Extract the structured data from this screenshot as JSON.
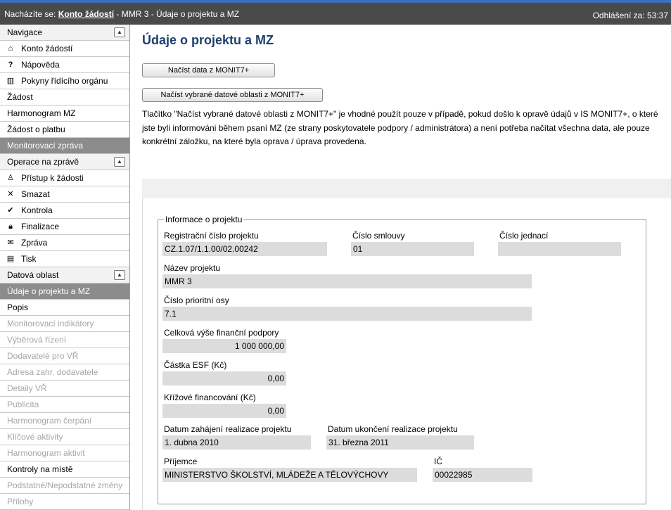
{
  "header": {
    "prefix": "Nacházíte se:",
    "crumb_link": "Konto žádostí",
    "crumb_rest": "- MMR 3 - Údaje o projektu a MZ",
    "timer_label": "Odhlášení za:",
    "timer_value": "53:37"
  },
  "sidebar": {
    "nav_header": "Navigace",
    "nav_items": [
      "Konto žádostí",
      "Nápověda",
      "Pokyny řídícího orgánu"
    ],
    "plain_items": [
      "Žádost",
      "Harmonogram MZ",
      "Žádost o platbu"
    ],
    "monitor_header": "Monitorovací zpráva",
    "ops_header": "Operace na zprávě",
    "ops_items": [
      "Přístup k žádosti",
      "Smazat",
      "Kontrola",
      "Finalizace",
      "Zpráva",
      "Tisk"
    ],
    "data_header": "Datová oblast",
    "data_active": "Údaje o projektu a MZ",
    "data_items": [
      "Popis"
    ],
    "disabled_items": [
      "Monitorovací indikátory",
      "Výběrová řízení",
      "Dodavatelé pro VŘ",
      "Adresa zahr. dodavatele",
      "Detaily VŘ",
      "Publicita",
      "Harmonogram čerpání",
      "Klíčové aktivity",
      "Harmonogram aktivit"
    ],
    "data_items2": [
      "Kontroly na místě"
    ],
    "disabled_items2": [
      "Podstatné/Nepodstatné změny",
      "Přílohy"
    ]
  },
  "main": {
    "title": "Údaje o projektu a MZ",
    "btn_load": "Načíst data z MONIT7+",
    "btn_load_selected": "Načíst vybrané datové oblasti z MONIT7+",
    "description": "Tlačítko \"Načíst vybrané datové oblasti z MONIT7+\" je vhodné použít pouze v případě, pokud došlo k opravě údajů v IS MONIT7+, o které jste byli informováni během psaní MZ (ze strany poskytovatele podpory / administrátora) a není potřeba načítat všechna data, ale pouze konkrétní záložku, na které byla oprava / úprava provedena."
  },
  "project": {
    "legend": "Informace o projektu",
    "reg_label": "Registrační číslo projektu",
    "reg_value": "CZ.1.07/1.1.00/02.00242",
    "contract_label": "Číslo smlouvy",
    "contract_value": "01",
    "ref_label": "Číslo jednací",
    "ref_value": "",
    "name_label": "Název projektu",
    "name_value": "MMR 3",
    "axis_label": "Číslo prioritní osy",
    "axis_value": "7.1",
    "total_label": "Celková výše finanční podpory",
    "total_value": "1 000 000,00",
    "esf_label": "Částka ESF (Kč)",
    "esf_value": "0,00",
    "cross_label": "Křížové financování (Kč)",
    "cross_value": "0,00",
    "start_label": "Datum zahájení realizace projektu",
    "start_value": "1. dubna 2010",
    "end_label": "Datum ukončení realizace projektu",
    "end_value": "31. března 2011",
    "recipient_label": "Příjemce",
    "recipient_value": "MINISTERSTVO ŠKOLSTVÍ, MLÁDEŽE A TĚLOVÝCHOVY",
    "ic_label": "IČ",
    "ic_value": "00022985"
  }
}
